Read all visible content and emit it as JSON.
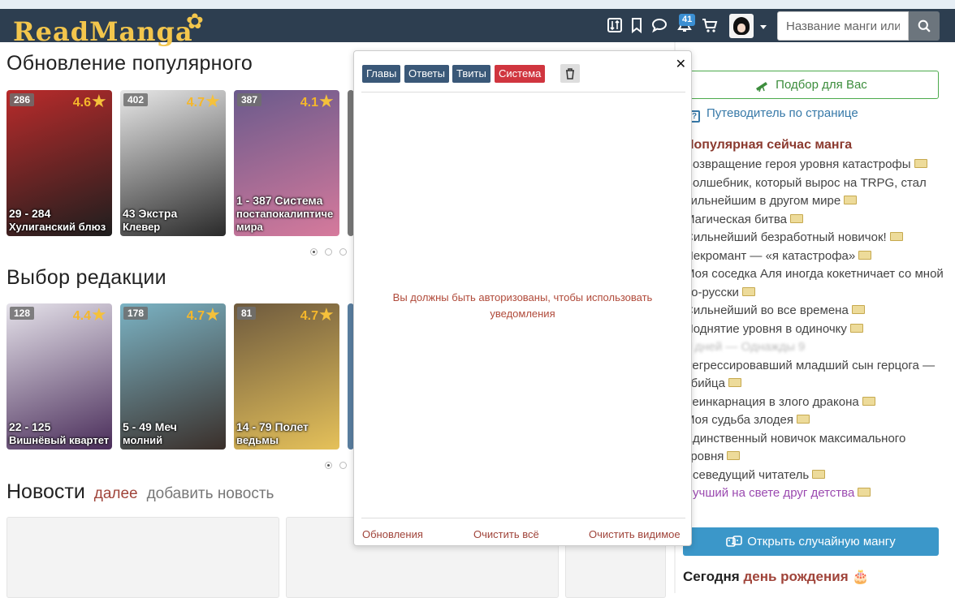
{
  "header": {
    "logo": "ReadManga",
    "notifications_count": "41",
    "search_placeholder": "Название манги или автора"
  },
  "popular_updates": {
    "title": "Обновление популярного",
    "cards": [
      {
        "count": "286",
        "rating": "4.6",
        "chapters": "29 - 284",
        "name": "Хулиганский блюз",
        "colors": [
          "#b92b2b",
          "#1e1e1e"
        ]
      },
      {
        "count": "402",
        "rating": "4.7",
        "chapters": "43 Экстра",
        "name": "Клевер",
        "colors": [
          "#e8e8e8",
          "#2a2a2a"
        ]
      },
      {
        "count": "387",
        "rating": "4.1",
        "chapters": "1 - 387 Система",
        "name": "постапокалиптиче мира",
        "colors": [
          "#6a5a8c",
          "#d67a9c"
        ]
      }
    ]
  },
  "editors_choice": {
    "title": "Выбор редакции",
    "cards": [
      {
        "count": "128",
        "rating": "4.4",
        "chapters": "22 - 125",
        "name": "Вишнёвый квартет",
        "colors": [
          "#e5e2ea",
          "#4a2d5a"
        ]
      },
      {
        "count": "178",
        "rating": "4.7",
        "chapters": "5 - 49 Меч",
        "name": "молний",
        "colors": [
          "#7bb3c4",
          "#3a2f2a"
        ]
      },
      {
        "count": "81",
        "rating": "4.7",
        "chapters": "14 - 79 Полет",
        "name": "ведьмы",
        "colors": [
          "#6e5a3e",
          "#e5c15a"
        ]
      }
    ]
  },
  "news": {
    "title": "Новости",
    "more_link": "далее",
    "add_link": "добавить новость"
  },
  "notifications_popup": {
    "tabs": [
      {
        "label": "Главы",
        "color": "#3a5878"
      },
      {
        "label": "Ответы",
        "color": "#3a5878"
      },
      {
        "label": "Твиты",
        "color": "#3a5878"
      },
      {
        "label": "Система",
        "color": "#d0353f"
      }
    ],
    "message": "Вы должны быть авторизованы, чтобы использовать уведомления",
    "footer": {
      "updates": "Обновления",
      "clear_all": "Очистить всё",
      "clear_visible": "Очистить видимое"
    }
  },
  "sidebar": {
    "pick_button": "Подбор для Вас",
    "guide_link": "Путеводитель по странице",
    "popular_title": "Популярная сейчас манга",
    "popular_items": [
      "Возвращение героя уровня катастрофы",
      "Волшебник, который вырос на TRPG, стал сильнейшим в другом мире",
      "Магическая битва",
      "Сильнейший безработный новичок!",
      "Некромант — «я катастрофа»",
      "Моя соседка Аля иногда кокетничает со мной по-русски",
      "Сильнейший во все времена",
      "Поднятие уровня в одиночку",
      "9 дней — Однажды 9",
      "Регрессировавший младший сын герцога — убийца",
      "Реинкарнация в злого дракона",
      "Моя судьба злодея",
      "Единственный новичок максимального уровня",
      "Всеведущий читатель",
      "Лучший на свете друг детства"
    ],
    "random_button": "Открыть случайную мангу",
    "birthday_prefix": "Сегодня",
    "birthday_accent": "день рождения"
  }
}
